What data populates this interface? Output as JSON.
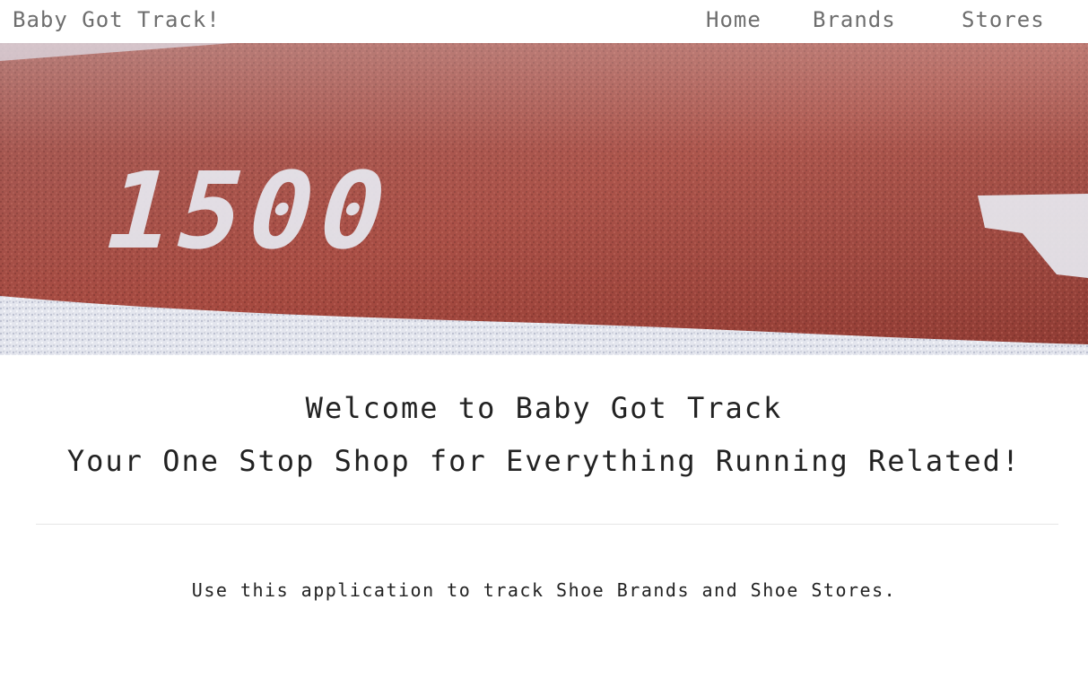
{
  "navbar": {
    "brand": "Baby Got Track!",
    "links": [
      {
        "label": "Home"
      },
      {
        "label": "Brands"
      },
      {
        "label": "Stores"
      }
    ]
  },
  "hero": {
    "track_number": "1500"
  },
  "main": {
    "welcome": "Welcome to Baby Got Track",
    "tagline": "Your One Stop Shop for Everything Running Related!",
    "intro": "Use this application to track Shoe Brands and Shoe Stores."
  },
  "colors": {
    "nav_text": "#6e6e6e",
    "body_text": "#222222",
    "track_red": "#a5473d",
    "track_line": "#e4e6ee"
  }
}
